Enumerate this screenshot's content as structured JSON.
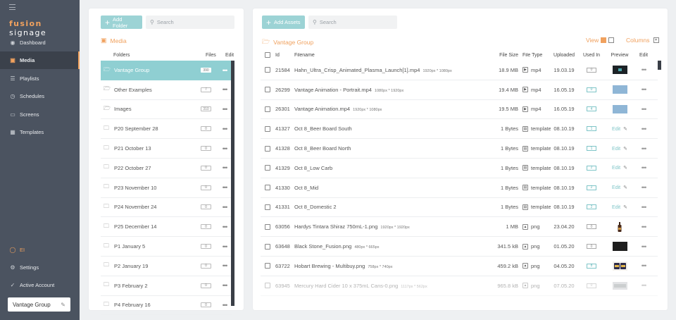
{
  "sidebar": {
    "logo_a": "fusion",
    "logo_b": " signage",
    "nav": [
      {
        "label": "Dashboard",
        "icon": "globe-icon"
      },
      {
        "label": "Media",
        "icon": "media-icon",
        "active": true
      },
      {
        "label": "Playlists",
        "icon": "playlists-icon"
      },
      {
        "label": "Schedules",
        "icon": "schedules-icon"
      },
      {
        "label": "Screens",
        "icon": "screens-icon"
      },
      {
        "label": "Templates",
        "icon": "templates-icon"
      }
    ],
    "user": "EI",
    "settings": "Settings",
    "active_account": "Active Account",
    "account_name": "Vantage Group"
  },
  "folders_panel": {
    "add_button": "Add Folder",
    "search_placeholder": "Search",
    "section_title": "Media",
    "col_folders": "Folders",
    "col_files": "Files",
    "col_edit": "Edit",
    "rows": [
      {
        "name": "Vantage Group",
        "count": "390",
        "selected": true,
        "icon": "folder-open-icon"
      },
      {
        "name": "Other Examples",
        "count": "7",
        "icon": "folder-open-icon"
      },
      {
        "name": "Images",
        "count": "310",
        "icon": "folder-open-icon"
      },
      {
        "name": "P20 September 28",
        "count": "0",
        "icon": "folder-icon"
      },
      {
        "name": "P21 October 13",
        "count": "0",
        "icon": "folder-icon"
      },
      {
        "name": "P22 October 27",
        "count": "0",
        "icon": "folder-icon"
      },
      {
        "name": "P23 November 10",
        "count": "0",
        "icon": "folder-icon"
      },
      {
        "name": "P24 November 24",
        "count": "0",
        "icon": "folder-icon"
      },
      {
        "name": "P25 December 14",
        "count": "0",
        "icon": "folder-icon"
      },
      {
        "name": "P1 January 5",
        "count": "0",
        "icon": "folder-icon"
      },
      {
        "name": "P2 January 19",
        "count": "0",
        "icon": "folder-icon"
      },
      {
        "name": "P3 February 2",
        "count": "0",
        "icon": "folder-icon"
      },
      {
        "name": "P4 February 16",
        "count": "0",
        "icon": "folder-icon"
      }
    ]
  },
  "assets_panel": {
    "add_button": "Add Assets",
    "search_placeholder": "Search",
    "section_title": "Vantage Group",
    "view_label": "View",
    "columns_label": "Columns",
    "headers": {
      "id": "Id",
      "filename": "Filename",
      "size": "File Size",
      "type": "File Type",
      "uploaded": "Uploaded",
      "used": "Used In",
      "preview": "Preview",
      "edit": "Edit"
    },
    "edit_label": "Edit",
    "rows": [
      {
        "id": "21584",
        "name": "Hahn_Ultra_Crisp_Animated_Plasma_Launch[1].mp4",
        "dim": "1920px * 1080px",
        "size": "18.9 MB",
        "type": "mp4",
        "type_icon": "video-file-icon",
        "uploaded": "19.03.19",
        "used": "0",
        "used_teal": false,
        "preview": "dark-video"
      },
      {
        "id": "26299",
        "name": "Vantage Animation - Portrait.mp4",
        "dim": "1080px * 1920px",
        "size": "19.4 MB",
        "type": "mp4",
        "type_icon": "video-file-icon",
        "uploaded": "16.05.19",
        "used": "0",
        "used_teal": true,
        "preview": "blue"
      },
      {
        "id": "26301",
        "name": "Vantage Animation.mp4",
        "dim": "1920px * 1080px",
        "size": "19.5 MB",
        "type": "mp4",
        "type_icon": "video-file-icon",
        "uploaded": "16.05.19",
        "used": "4",
        "used_teal": true,
        "preview": "blue"
      },
      {
        "id": "41327",
        "name": "Oct 8_Beer Board South",
        "dim": "",
        "size": "1 Bytes",
        "type": "template",
        "type_icon": "template-icon",
        "uploaded": "08.10.19",
        "used": "1",
        "used_teal": true,
        "preview": "edit"
      },
      {
        "id": "41328",
        "name": "Oct 8_Beer Board North",
        "dim": "",
        "size": "1 Bytes",
        "type": "template",
        "type_icon": "template-icon",
        "uploaded": "08.10.19",
        "used": "1",
        "used_teal": true,
        "preview": "edit"
      },
      {
        "id": "41329",
        "name": "Oct 8_Low Carb",
        "dim": "",
        "size": "1 Bytes",
        "type": "template",
        "type_icon": "template-icon",
        "uploaded": "08.10.19",
        "used": "2",
        "used_teal": true,
        "preview": "edit"
      },
      {
        "id": "41330",
        "name": "Oct 8_Mid",
        "dim": "",
        "size": "1 Bytes",
        "type": "template",
        "type_icon": "template-icon",
        "uploaded": "08.10.19",
        "used": "2",
        "used_teal": true,
        "preview": "edit"
      },
      {
        "id": "41331",
        "name": "Oct 8_Domestic 2",
        "dim": "",
        "size": "1 Bytes",
        "type": "template",
        "type_icon": "template-icon",
        "uploaded": "08.10.19",
        "used": "2",
        "used_teal": true,
        "preview": "edit"
      },
      {
        "id": "63056",
        "name": "Hardys Tintara Shiraz 750mL-1.png",
        "dim": "1920px * 1920px",
        "size": "1 MB",
        "type": "png",
        "type_icon": "image-file-icon",
        "uploaded": "23.04.20",
        "used": "0",
        "used_teal": false,
        "preview": "bottle"
      },
      {
        "id": "63648",
        "name": "Black Stone_Fusion.png",
        "dim": "480px * 665px",
        "size": "341.5 kB",
        "type": "png",
        "type_icon": "image-file-icon",
        "uploaded": "01.05.20",
        "used": "0",
        "used_teal": false,
        "preview": "dark"
      },
      {
        "id": "63722",
        "name": "Hobart Brewing - Multibuy.png",
        "dim": "758px * 740px",
        "size": "459.2 kB",
        "type": "png",
        "type_icon": "image-file-icon",
        "uploaded": "04.05.20",
        "used": "8",
        "used_teal": true,
        "preview": "cans"
      },
      {
        "id": "63945",
        "name": "Mercury Hard Cider 10 x 375mL Cans-0.png",
        "dim": "1117px * 562px",
        "size": "965.8 kB",
        "type": "png",
        "type_icon": "image-file-icon",
        "uploaded": "07.05.20",
        "used": "0",
        "used_teal": false,
        "preview": "silver",
        "faded": true
      }
    ]
  }
}
